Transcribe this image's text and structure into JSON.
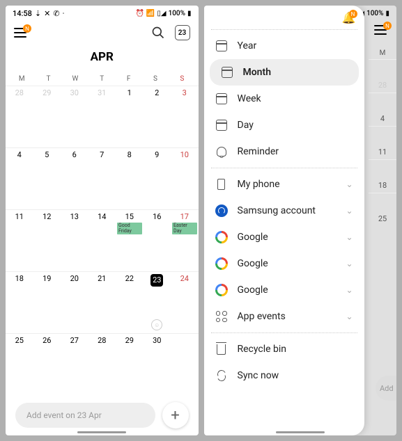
{
  "status": {
    "time": "14:58",
    "battery": "100%",
    "wifi": "wifi-icon",
    "signal": "signal-icon"
  },
  "screen1": {
    "today": "23",
    "month": "APR",
    "dow": [
      "M",
      "T",
      "W",
      "T",
      "F",
      "S",
      "S"
    ],
    "weeks": [
      [
        {
          "n": "28",
          "p": 1
        },
        {
          "n": "29",
          "p": 1
        },
        {
          "n": "30",
          "p": 1
        },
        {
          "n": "31",
          "p": 1
        },
        {
          "n": "1"
        },
        {
          "n": "2"
        },
        {
          "n": "3",
          "s": 1
        }
      ],
      [
        {
          "n": "4"
        },
        {
          "n": "5"
        },
        {
          "n": "6"
        },
        {
          "n": "7"
        },
        {
          "n": "8"
        },
        {
          "n": "9"
        },
        {
          "n": "10",
          "s": 1
        }
      ],
      [
        {
          "n": "11"
        },
        {
          "n": "12"
        },
        {
          "n": "13"
        },
        {
          "n": "14"
        },
        {
          "n": "15",
          "e": "Good Friday"
        },
        {
          "n": "16"
        },
        {
          "n": "17",
          "s": 1,
          "e": "Easter Day"
        }
      ],
      [
        {
          "n": "18"
        },
        {
          "n": "19"
        },
        {
          "n": "20"
        },
        {
          "n": "21"
        },
        {
          "n": "22"
        },
        {
          "n": "23",
          "sel": 1,
          "face": 1
        },
        {
          "n": "24",
          "s": 1
        }
      ],
      [
        {
          "n": "25"
        },
        {
          "n": "26"
        },
        {
          "n": "27"
        },
        {
          "n": "28"
        },
        {
          "n": "29"
        },
        {
          "n": "30"
        },
        {
          "n": ""
        }
      ]
    ],
    "add_placeholder": "Add event on 23 Apr"
  },
  "screen2": {
    "views": [
      {
        "icon": "cal",
        "label": "Year"
      },
      {
        "icon": "cal",
        "label": "Month",
        "active": true
      },
      {
        "icon": "cal",
        "label": "Week"
      },
      {
        "icon": "cal",
        "label": "Day"
      },
      {
        "icon": "bell",
        "label": "Reminder"
      }
    ],
    "accounts": [
      {
        "icon": "phone",
        "label": "My phone"
      },
      {
        "icon": "samsung",
        "label": "Samsung account"
      },
      {
        "icon": "google",
        "label": "Google"
      },
      {
        "icon": "google",
        "label": "Google"
      },
      {
        "icon": "google",
        "label": "Google"
      },
      {
        "icon": "dots",
        "label": "App events"
      }
    ],
    "actions": [
      {
        "icon": "trash",
        "label": "Recycle bin"
      },
      {
        "icon": "sync",
        "label": "Sync now"
      }
    ],
    "peek_days": [
      "M",
      "28",
      "4",
      "11",
      "18",
      "25"
    ],
    "add_peek": "Add"
  }
}
